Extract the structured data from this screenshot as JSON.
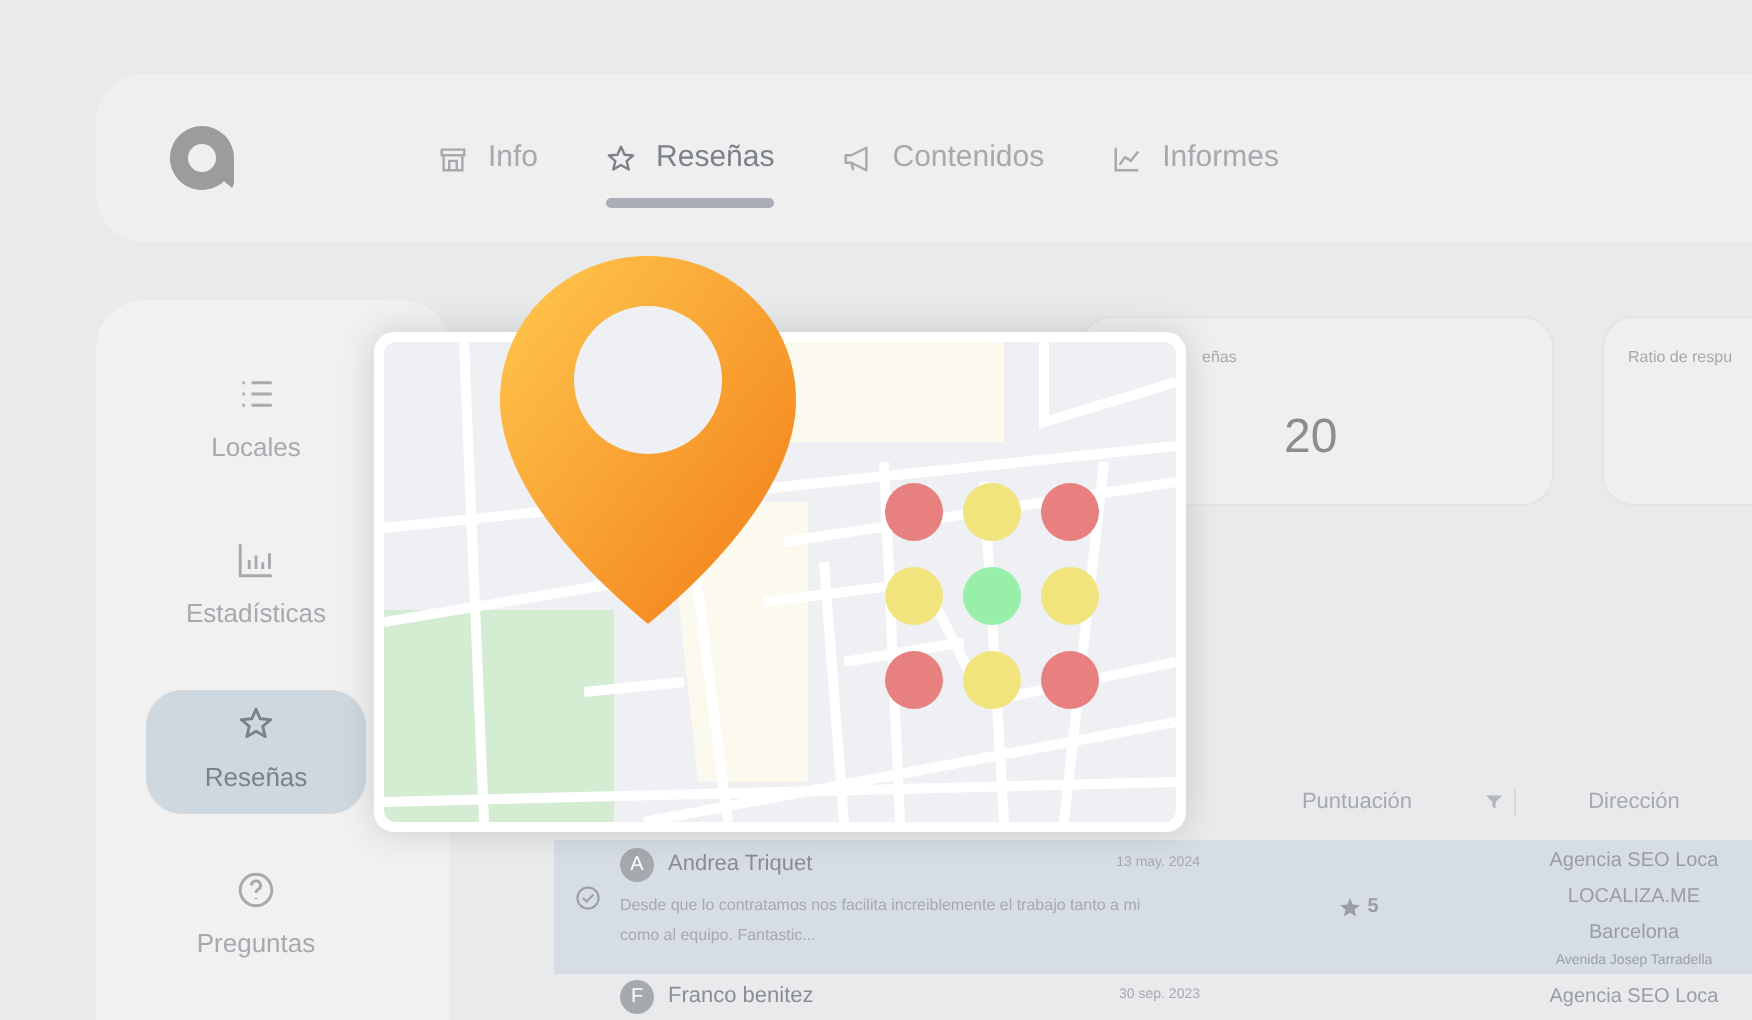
{
  "nav_tabs": [
    {
      "label": "Info",
      "selected": false
    },
    {
      "label": "Reseñas",
      "selected": true
    },
    {
      "label": "Contenidos",
      "selected": false
    },
    {
      "label": "Informes",
      "selected": false
    }
  ],
  "sidebar": {
    "items": [
      {
        "label": "Locales",
        "selected": false
      },
      {
        "label": "Estadísticas",
        "selected": false
      },
      {
        "label": "Reseñas",
        "selected": true
      },
      {
        "label": "Preguntas",
        "selected": false
      }
    ]
  },
  "stat_cards": [
    {
      "label": "eñas",
      "value": "20"
    },
    {
      "label": "Ratio de respu"
    }
  ],
  "table": {
    "columns": [
      "Puntuación",
      "Dirección"
    ],
    "rows": [
      {
        "selected": true,
        "initial": "A",
        "name": "Andrea Triquet",
        "date": "13 may. 2024",
        "text": "Desde que lo contratamos nos facilita increiblemente el trabajo tanto a mi como al equipo. Fantastic...",
        "score": "5",
        "address": [
          "Agencia SEO Loca",
          "LOCALIZA.ME",
          "Barcelona",
          "Avenida Josep Tarradella"
        ]
      },
      {
        "selected": false,
        "initial": "F",
        "name": "Franco benitez",
        "date": "30 sep. 2023",
        "address": [
          "Agencia SEO Loca"
        ]
      }
    ]
  },
  "map_overlay": {
    "grid_points": [
      {
        "color": "#e88080"
      },
      {
        "color": "#f2e47d"
      },
      {
        "color": "#e88080"
      },
      {
        "color": "#f2e47d"
      },
      {
        "color": "#98f0a8"
      },
      {
        "color": "#f2e47d"
      },
      {
        "color": "#e88080"
      },
      {
        "color": "#f2e47d"
      },
      {
        "color": "#e88080"
      }
    ]
  }
}
